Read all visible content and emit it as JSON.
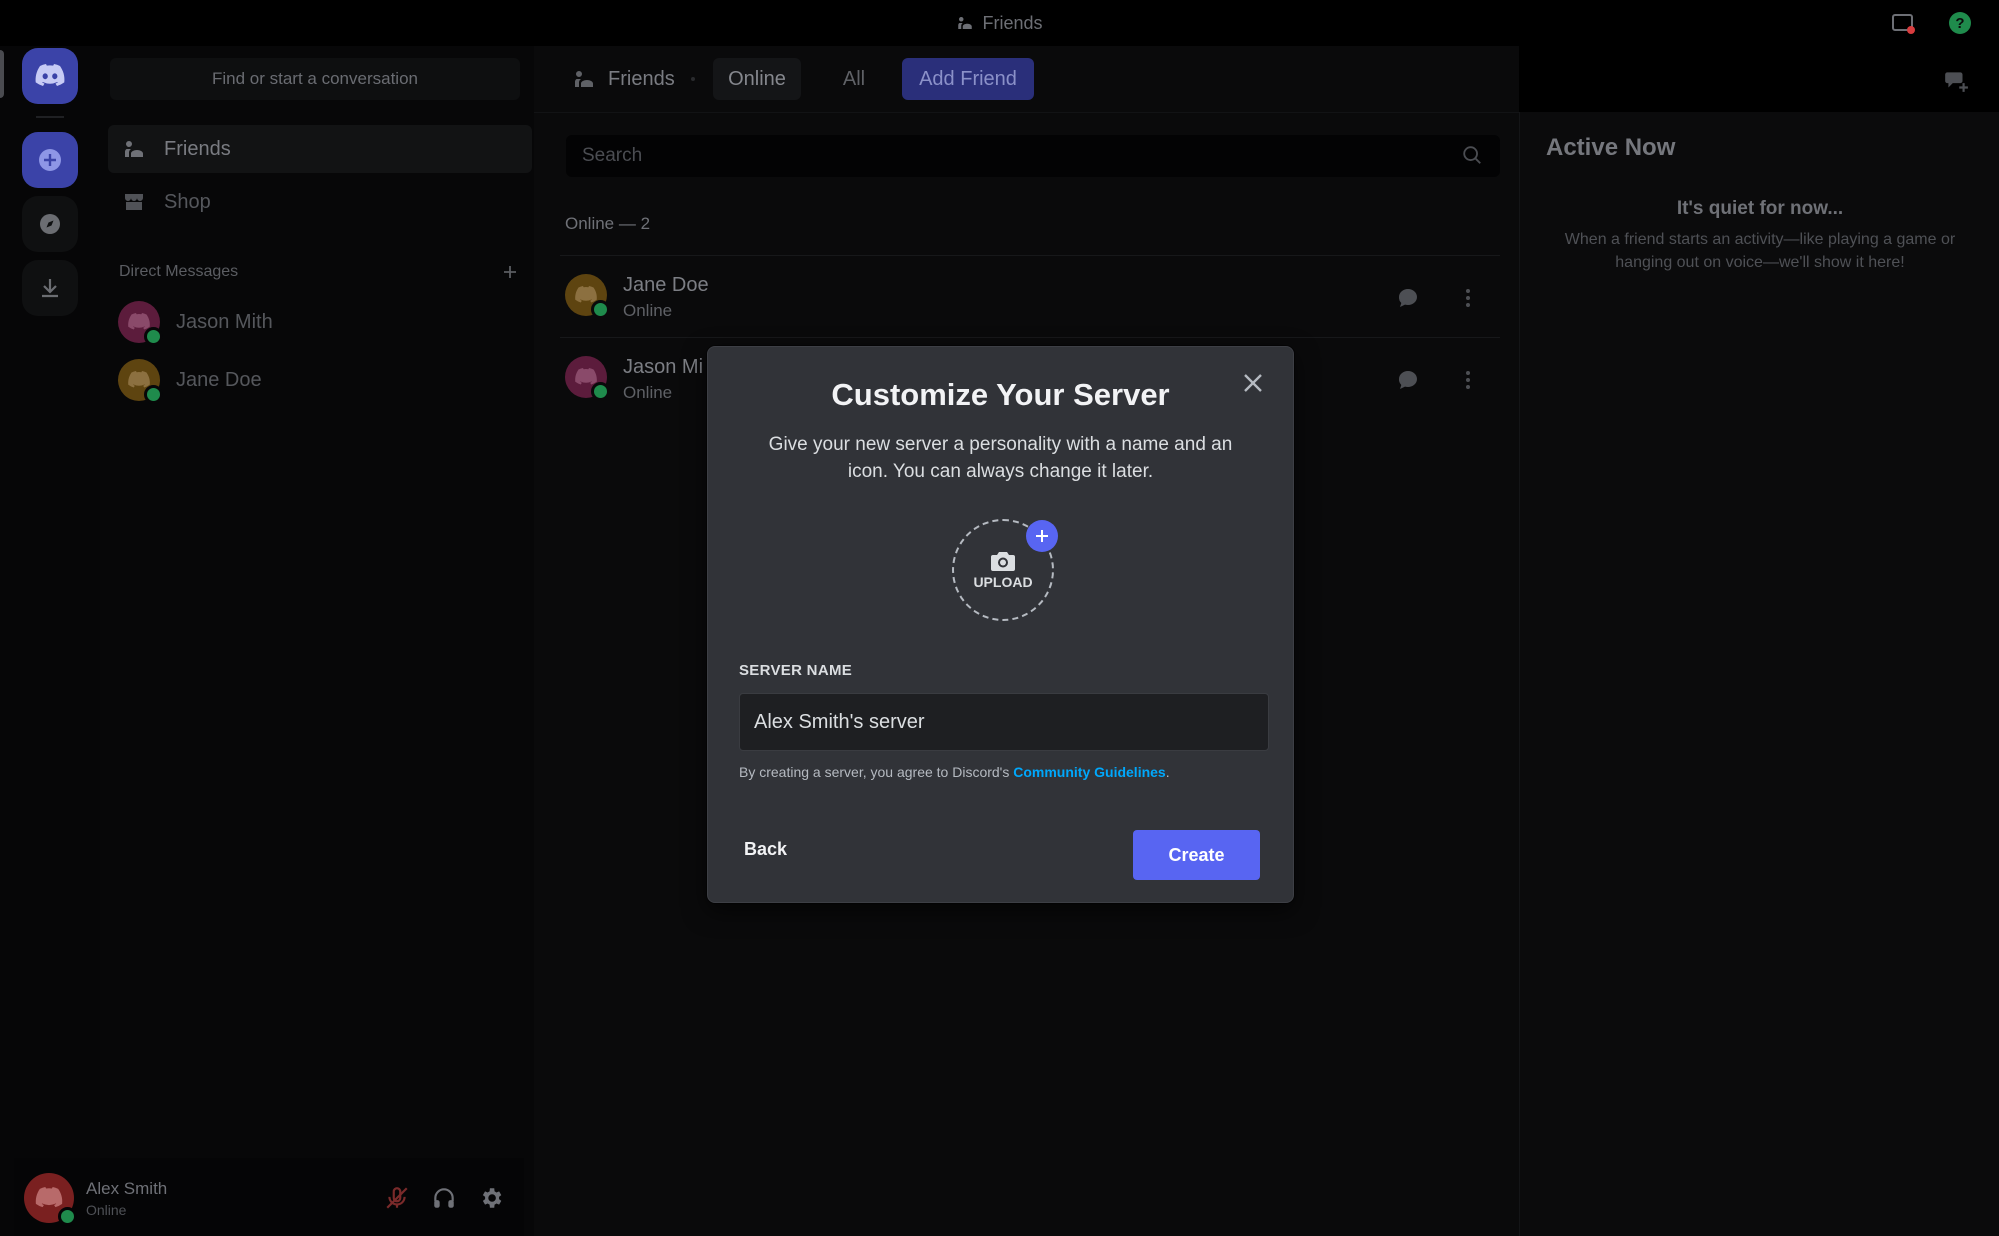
{
  "window": {
    "title": "Friends"
  },
  "sidebar": {
    "search_placeholder": "Find or start a conversation",
    "nav": [
      {
        "label": "Friends"
      },
      {
        "label": "Shop"
      }
    ],
    "dm_title": "Direct Messages",
    "dms": [
      {
        "name": "Jason Mith",
        "avatar_color": "#c0357a"
      },
      {
        "name": "Jane Doe",
        "avatar_color": "#c98b19"
      }
    ]
  },
  "user": {
    "name": "Alex Smith",
    "status": "Online",
    "avatar_color": "#d53636"
  },
  "topbar": {
    "friends_label": "Friends",
    "tabs": [
      "Online",
      "All"
    ],
    "add_friend": "Add Friend"
  },
  "main": {
    "search_placeholder": "Search",
    "online_count": "Online — 2",
    "friends": [
      {
        "name": "Jane Doe",
        "status": "Online",
        "avatar_color": "#c98b19"
      },
      {
        "name": "Jason Mi",
        "status": "Online",
        "avatar_color": "#c0357a"
      }
    ]
  },
  "active_now": {
    "title": "Active Now",
    "quiet_title": "It's quiet for now...",
    "quiet_text": "When a friend starts an activity—like playing a game or hanging out on voice—we'll show it here!"
  },
  "modal": {
    "title": "Customize Your Server",
    "subtitle": "Give your new server a personality with a name and an icon. You can always change it later.",
    "upload_label": "UPLOAD",
    "server_name_label": "SERVER NAME",
    "server_name_value": "Alex Smith's server",
    "legal_prefix": "By creating a server, you agree to Discord's ",
    "legal_link": "Community Guidelines",
    "legal_suffix": ".",
    "back_label": "Back",
    "create_label": "Create"
  },
  "colors": {
    "accent": "#5865f2",
    "online": "#23a55a",
    "link": "#00a8fc"
  }
}
